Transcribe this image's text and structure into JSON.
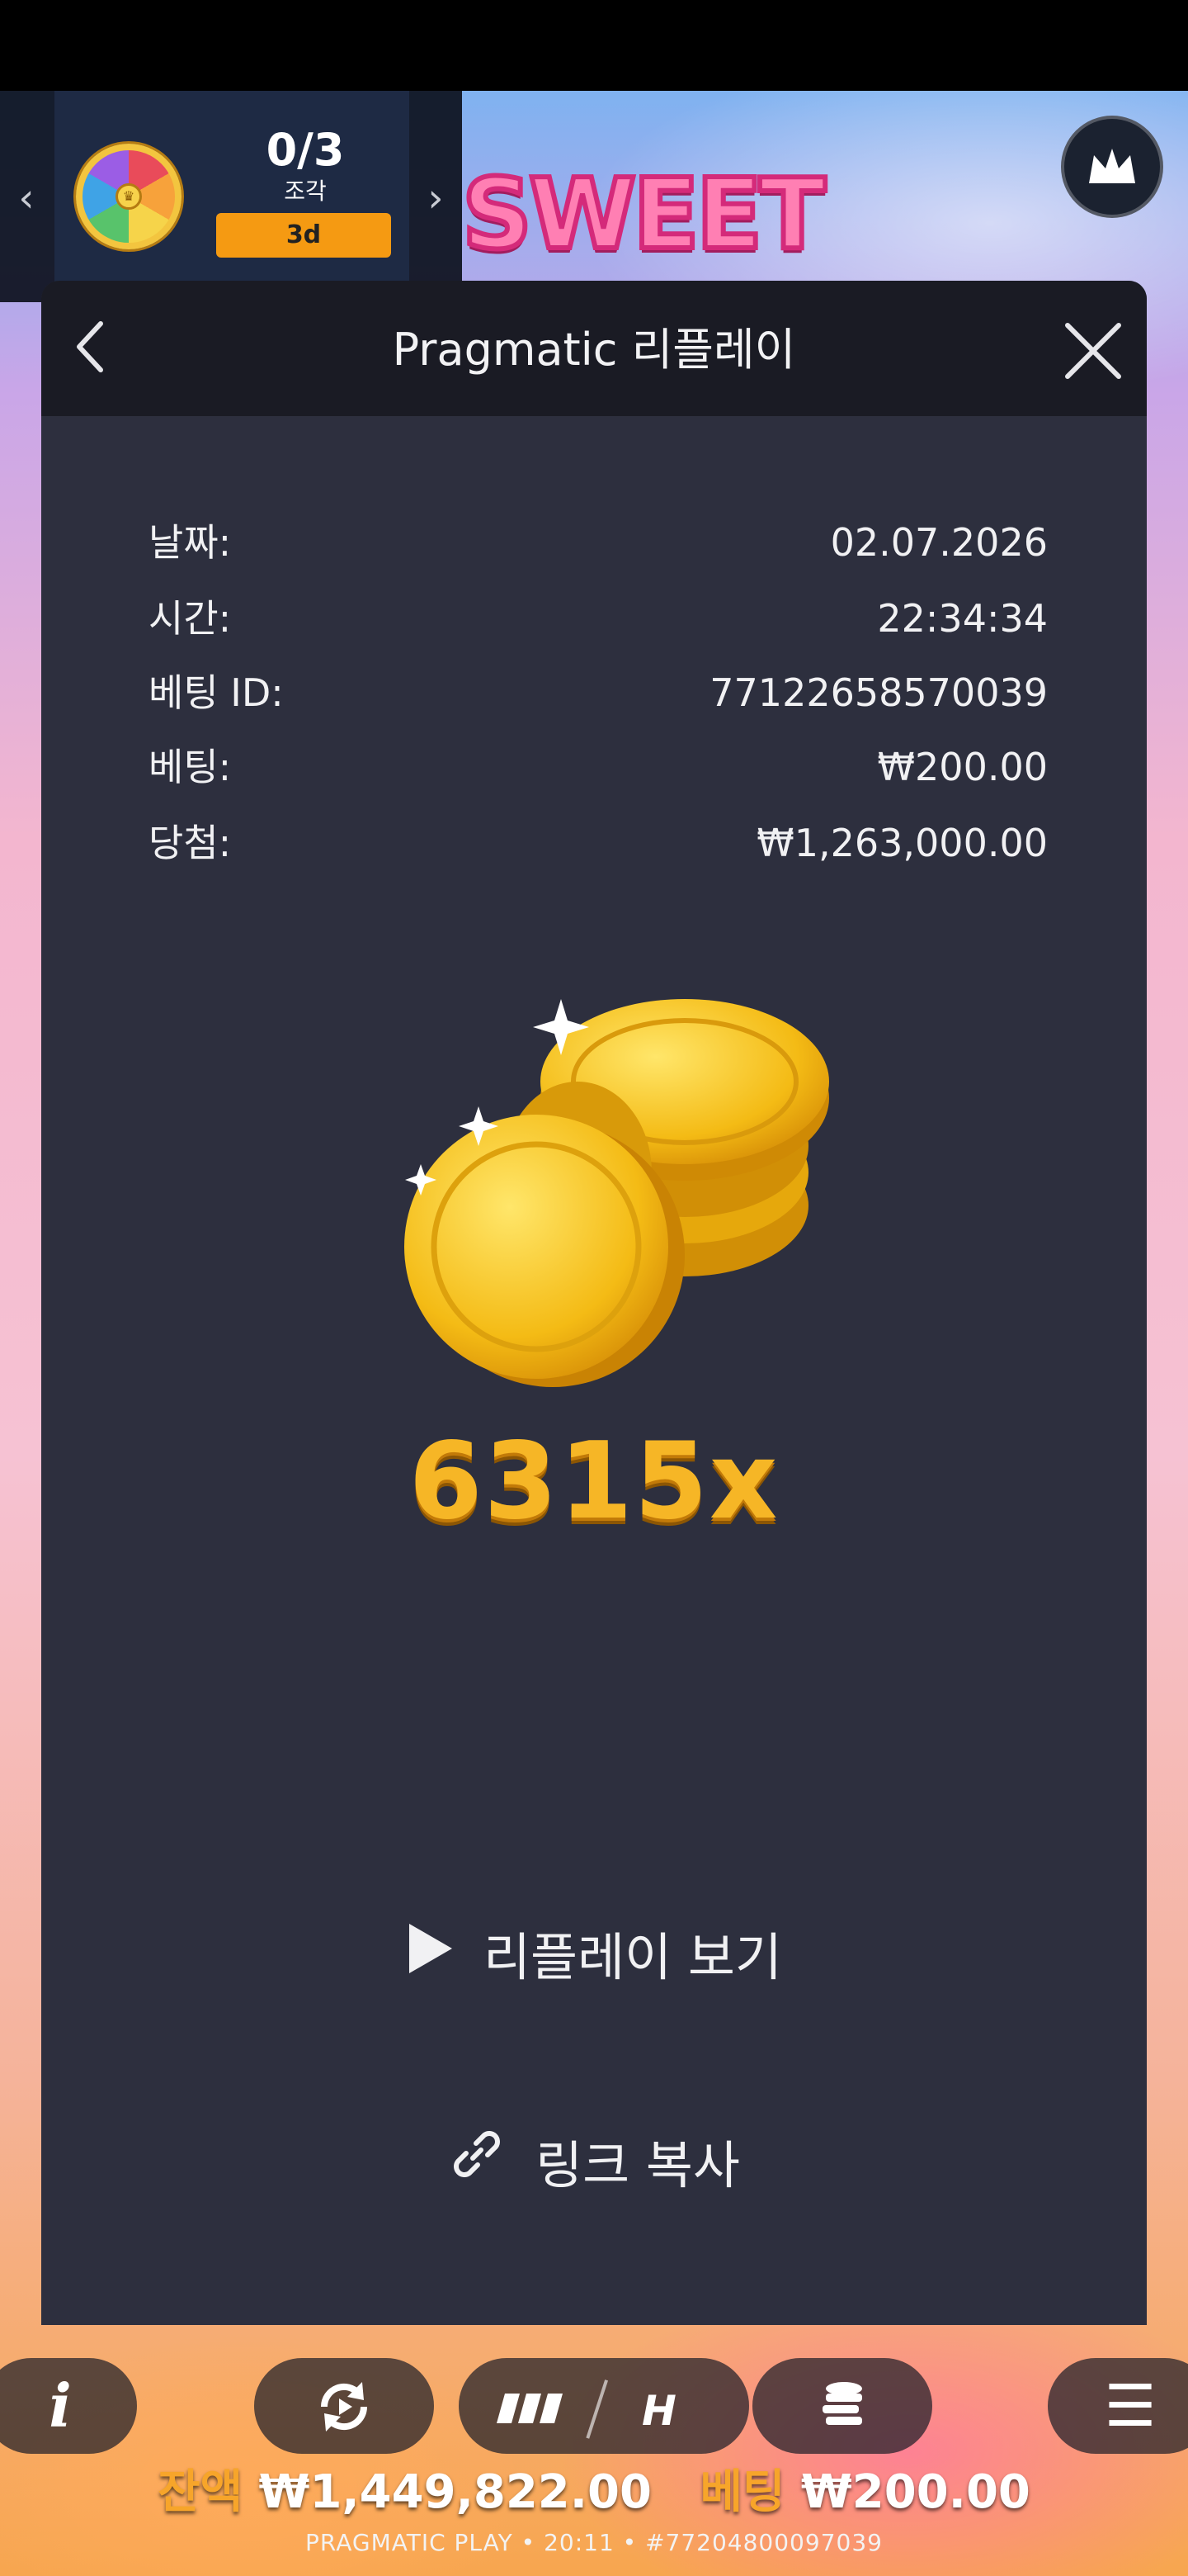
{
  "promo": {
    "count": "0/3",
    "label": "조각",
    "badge": "3d"
  },
  "logo": {
    "text": "SWEET"
  },
  "modal": {
    "title": "Pragmatic 리플레이",
    "rows": [
      {
        "key": "날짜:",
        "value": "02.07.2026"
      },
      {
        "key": "시간:",
        "value": "22:34:34"
      },
      {
        "key": "베팅 ID:",
        "value": "77122658570039"
      },
      {
        "key": "베팅:",
        "value": "₩200.00"
      },
      {
        "key": "당첨:",
        "value": "₩1,263,000.00"
      }
    ],
    "multiplier": "6315x",
    "watch_label": "리플레이 보기",
    "copy_label": "링크 복사"
  },
  "bottom": {
    "info_label": "i",
    "menu_label": "☰",
    "balance_label": "잔액",
    "balance_value": "₩1,449,822.00",
    "bet_label": "베팅",
    "bet_value": "₩200.00",
    "footer": "PRAGMATIC PLAY • 20:11 • #77204800097039"
  },
  "colors": {
    "modal_bg": "#2d2f3e",
    "header_bg": "#1a1b24",
    "accent_gold": "#f6b626",
    "badge_orange": "#f59a12"
  },
  "icons": [
    "chevron-left-icon",
    "chevron-right-icon",
    "prize-wheel-icon",
    "crown-icon",
    "back-icon",
    "close-icon",
    "gold-coins-icon",
    "play-icon",
    "link-icon",
    "autoplay-icon",
    "turbo-icon",
    "coins-stack-icon",
    "menu-icon"
  ]
}
